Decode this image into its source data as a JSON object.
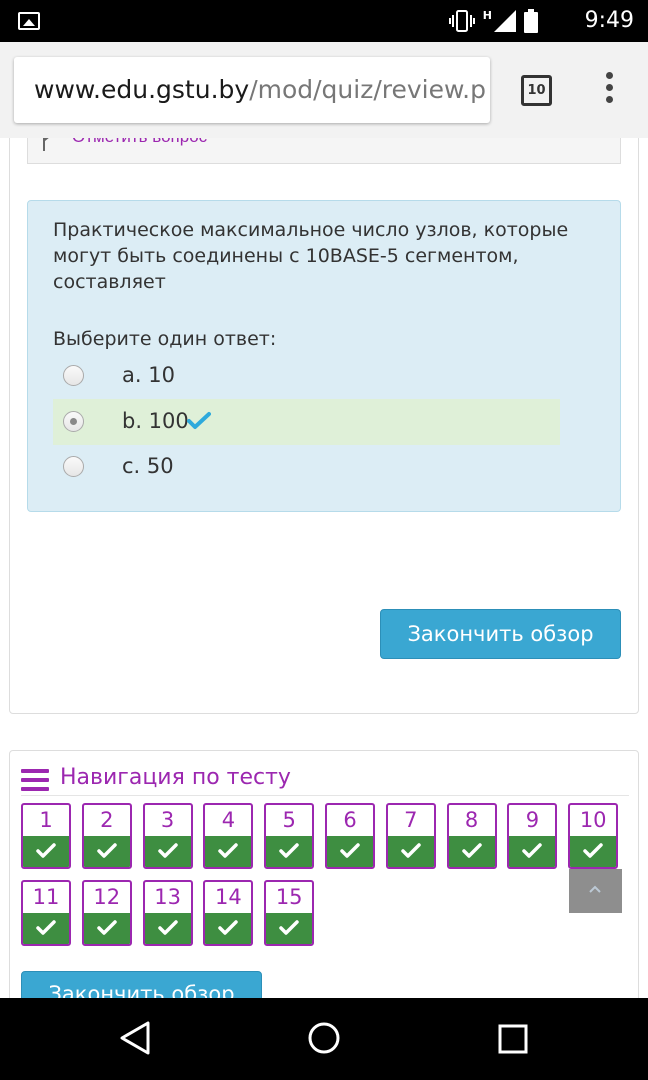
{
  "statusbar": {
    "time": "9:49",
    "network": "H",
    "icons": [
      "gallery-icon",
      "vibrate-icon",
      "signal-icon",
      "battery-icon"
    ]
  },
  "browser": {
    "url_host": "www.edu.gstu.by",
    "url_path": "/mod/quiz/review.p",
    "tab_count": "10"
  },
  "flag": {
    "label": "Отметить вопрос"
  },
  "question": {
    "text": "Практическое максимальное число узлов, которые могут быть соединены с 10BASE-5 сегментом, составляет",
    "prompt": "Выберите один ответ:",
    "options": [
      {
        "label": "a. 10",
        "selected": false,
        "correct": false
      },
      {
        "label": "b. 100",
        "selected": true,
        "correct": true
      },
      {
        "label": "c. 50",
        "selected": false,
        "correct": false
      }
    ]
  },
  "actions": {
    "finish_review": "Закончить обзор",
    "finish_review_bottom": "Закончить обзор"
  },
  "navigation": {
    "title": "Навигация по тесту",
    "questions": [
      "1",
      "2",
      "3",
      "4",
      "5",
      "6",
      "7",
      "8",
      "9",
      "10",
      "11",
      "12",
      "13",
      "14",
      "15"
    ],
    "status": "correct"
  },
  "colors": {
    "accent_purple": "#9c27b0",
    "button_blue": "#3aa7d2",
    "correct_green": "#3e8e41",
    "question_bg": "#dcedf5",
    "correct_bg": "#dff0d8"
  }
}
